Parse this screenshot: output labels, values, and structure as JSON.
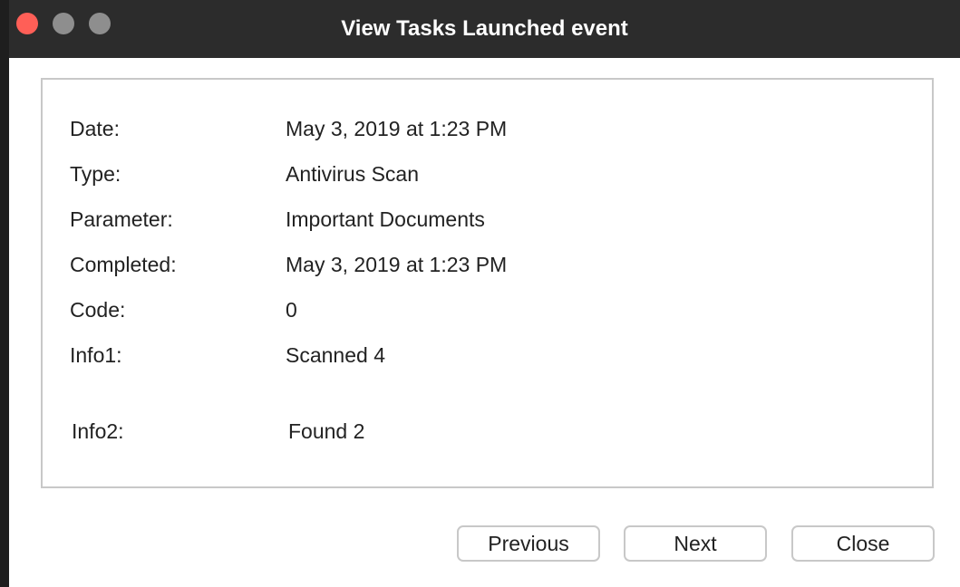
{
  "window": {
    "title": "View Tasks Launched event"
  },
  "details": [
    {
      "label": "Date:",
      "value": "May 3, 2019 at 1:23 PM"
    },
    {
      "label": "Type:",
      "value": "Antivirus Scan"
    },
    {
      "label": "Parameter:",
      "value": "Important Documents"
    },
    {
      "label": "Completed:",
      "value": "May 3, 2019 at 1:23 PM"
    },
    {
      "label": "Code:",
      "value": "0"
    },
    {
      "label": "Info1:",
      "value": "Scanned 4"
    },
    {
      "label": "Info2:",
      "value": "Found 2"
    }
  ],
  "buttons": {
    "previous": "Previous",
    "next": "Next",
    "close": "Close"
  },
  "colors": {
    "titlebar": "#2c2c2c",
    "close_light": "#ff5f57",
    "inactive_light": "#8e8e8e"
  }
}
